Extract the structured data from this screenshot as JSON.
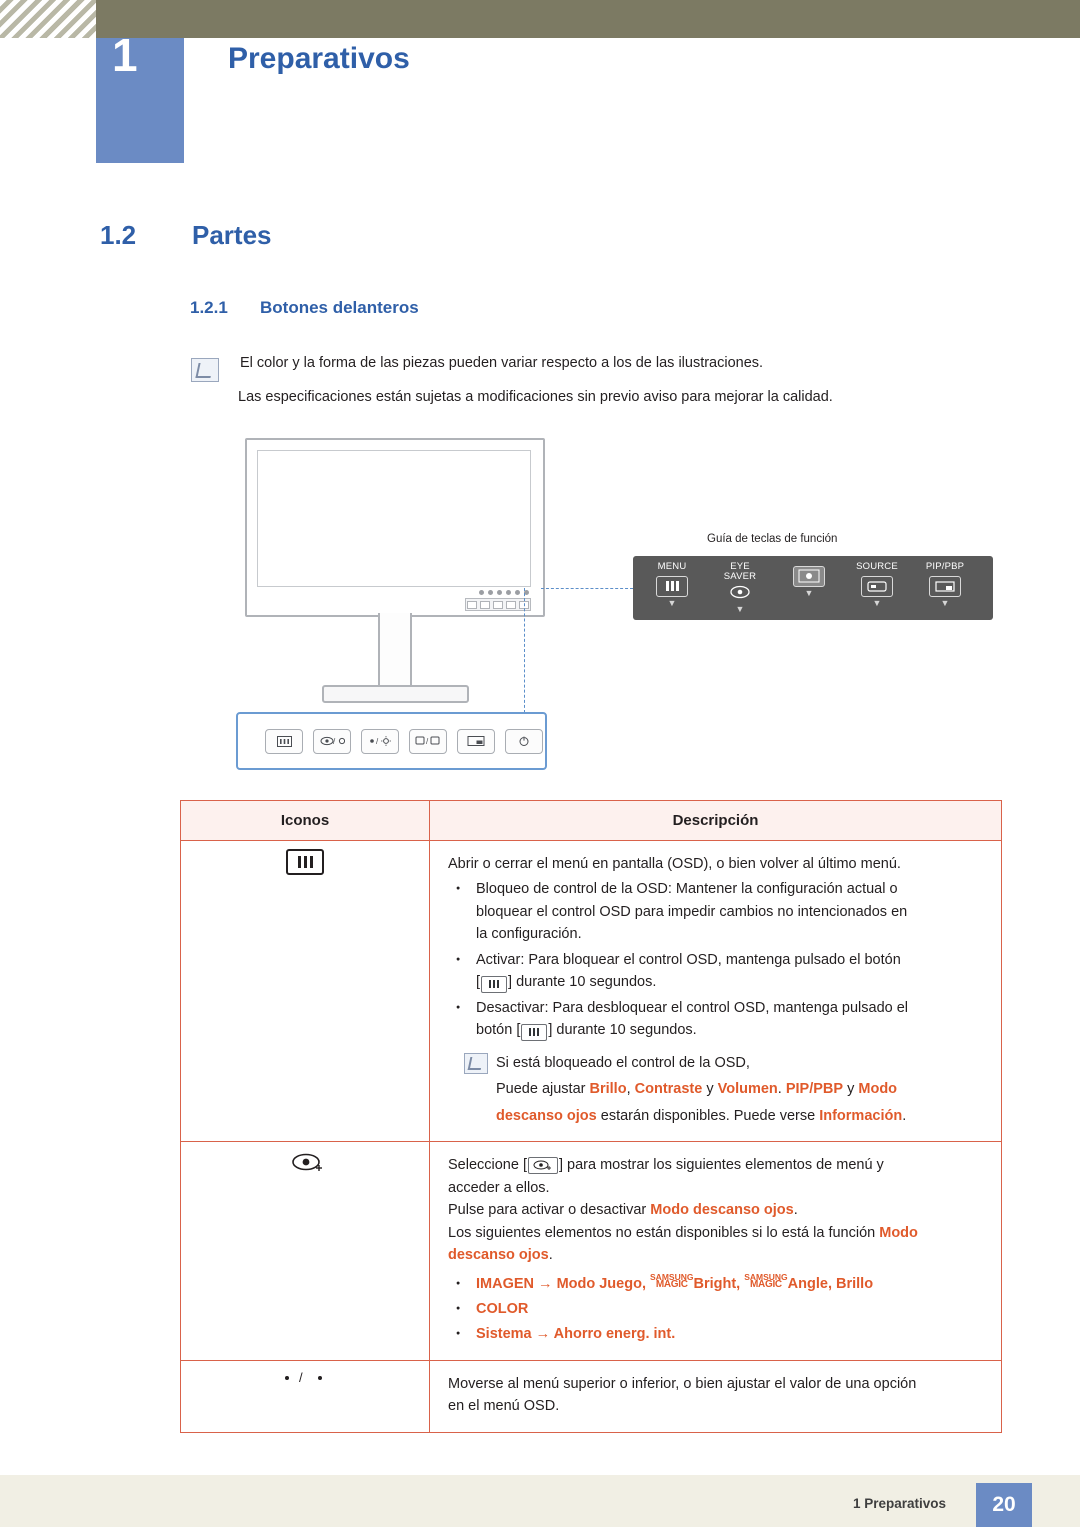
{
  "header": {
    "chapter_number": "1",
    "chapter_title": "Preparativos"
  },
  "section": {
    "number": "1.2",
    "title": "Partes",
    "sub_number": "1.2.1",
    "sub_title": "Botones delanteros"
  },
  "notes": {
    "line1": "El color y la forma de las piezas pueden variar respecto a los de las ilustraciones.",
    "line2": "Las especificaciones están sujetas a modificaciones sin previo aviso para mejorar la calidad."
  },
  "osd_guide": {
    "caption": "Guía de teclas de función",
    "keys": [
      {
        "label": "MENU",
        "icon": "menu-bars-icon"
      },
      {
        "label": "EYE\nSAVER",
        "label_line1": "EYE",
        "label_line2": "SAVER",
        "icon": "eye-saver-icon"
      },
      {
        "label": "",
        "icon": "brightness-icon"
      },
      {
        "label": "SOURCE",
        "icon": "source-icon"
      },
      {
        "label": "PIP/PBP",
        "icon": "pip-pbp-icon"
      }
    ]
  },
  "button_strip": {
    "buttons": [
      {
        "name": "menu-button",
        "glyph": "menu-bars-icon"
      },
      {
        "name": "eye-saver-button",
        "glyph": "eye-brightness-icon"
      },
      {
        "name": "brightness-button",
        "glyph": "updown-icon"
      },
      {
        "name": "source-button",
        "glyph": "source-icon"
      },
      {
        "name": "pip-pbp-button",
        "glyph": "pip-icon"
      },
      {
        "name": "power-button",
        "glyph": "power-icon"
      }
    ]
  },
  "table": {
    "headers": [
      "Iconos",
      "Descripción"
    ],
    "rows": [
      {
        "icon": "menu-bars-icon",
        "lines": [
          {
            "type": "plain",
            "text": "Abrir o cerrar el menú en pantalla (OSD), o bien volver al último menú."
          },
          {
            "type": "bullet",
            "text": "Bloqueo de control de la OSD: Mantener la configuración actual o"
          },
          {
            "type": "indent",
            "text": "bloquear el control OSD para impedir cambios no intencionados en"
          },
          {
            "type": "indent",
            "text": "la configuración."
          },
          {
            "type": "bullet",
            "text": "Activar: Para bloquear el control OSD, mantenga pulsado el botón"
          },
          {
            "type": "indent-key",
            "pre": "[",
            "post": "] durante 10 segundos."
          },
          {
            "type": "bullet",
            "text": "Desactivar: Para desbloquear el control OSD, mantenga pulsado el"
          },
          {
            "type": "indent-key2",
            "pre": "botón [",
            "post": "] durante 10 segundos."
          }
        ],
        "note": {
          "line1": "Si está bloqueado el control de la OSD,",
          "line2_parts": [
            {
              "t": "Puede ajustar ",
              "hl": false
            },
            {
              "t": "Brillo",
              "hl": true
            },
            {
              "t": ", ",
              "hl": false
            },
            {
              "t": "Contraste",
              "hl": true
            },
            {
              "t": " y ",
              "hl": false
            },
            {
              "t": "Volumen",
              "hl": true
            },
            {
              "t": ". ",
              "hl": false
            },
            {
              "t": "PIP/PBP",
              "hl": true
            },
            {
              "t": " y ",
              "hl": false
            },
            {
              "t": "Modo",
              "hl": true
            }
          ],
          "line3_parts": [
            {
              "t": "descanso ojos",
              "hl": true
            },
            {
              "t": " estarán disponibles. Puede verse ",
              "hl": false
            },
            {
              "t": "Información",
              "hl": true
            },
            {
              "t": ".",
              "hl": false
            }
          ]
        }
      },
      {
        "icon": "eye-saver-icon",
        "line1_pre": "Seleccione [",
        "line1_post": "] para mostrar los siguientes elementos de menú y",
        "line2": "acceder a ellos.",
        "line3_pre": "Pulse para activar o desactivar ",
        "line3_hl": "Modo descanso ojos",
        "line3_post": ".",
        "line4_pre": "Los siguientes elementos no están disponibles si lo está la función ",
        "line4_hl": "Modo",
        "line5_hl": "descanso ojos",
        "line5_post": ".",
        "bullets": [
          {
            "parts": [
              {
                "t": "IMAGEN",
                "hl": true
              },
              {
                "t": " → ",
                "hl": true
              },
              {
                "t": "Modo Juego",
                "hl": true
              },
              {
                "t": ", ",
                "hl": true
              },
              {
                "t": "MAGIC-BRIGHT",
                "hl": true,
                "magic": true,
                "magic_sup": "SAMSUNG",
                "magic_main": "MAGIC",
                "magic_after": "Bright"
              },
              {
                "t": ", ",
                "hl": true
              },
              {
                "t": "MAGIC-ANGLE",
                "hl": true,
                "magic": true,
                "magic_sup": "SAMSUNG",
                "magic_main": "MAGIC",
                "magic_after": "Angle"
              },
              {
                "t": ", ",
                "hl": true
              },
              {
                "t": "Brillo",
                "hl": true
              }
            ]
          },
          {
            "text": "COLOR",
            "hl": true
          },
          {
            "text": "Sistema → Ahorro energ. int.",
            "hl": true
          }
        ]
      },
      {
        "icon": "updown-arrows-icon",
        "line1": "Moverse al menú superior o inferior, o bien ajustar el valor de una opción",
        "line2": "en el menú OSD."
      }
    ]
  },
  "footer": {
    "text": "1 Preparativos",
    "page": "20"
  }
}
